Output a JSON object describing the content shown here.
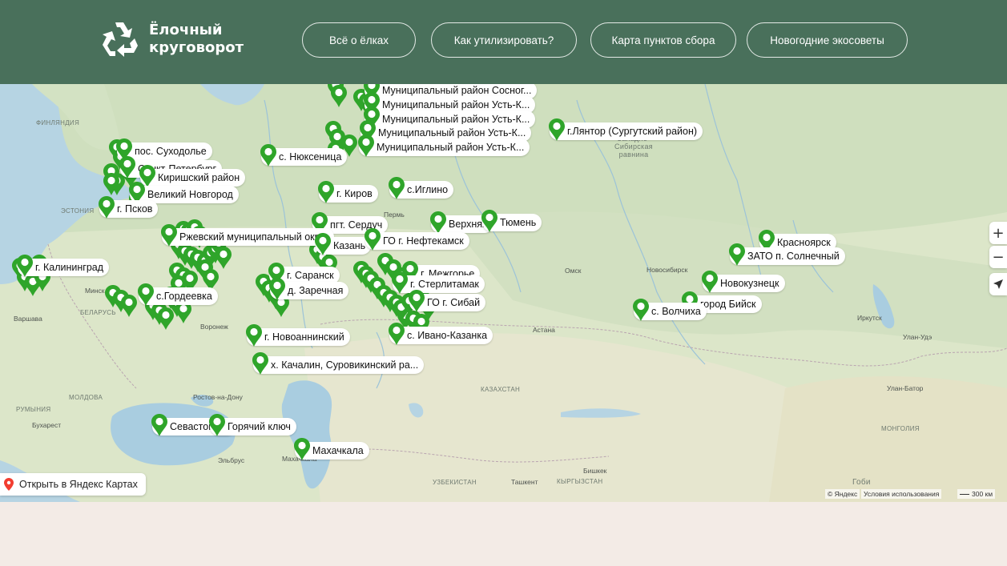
{
  "header": {
    "logo_line1": "Ёлочный",
    "logo_line2": "круговорот",
    "nav": [
      {
        "label": "Всё о ёлках"
      },
      {
        "label": "Как утилизировать?"
      },
      {
        "label": "Карта пунктов сбора"
      },
      {
        "label": "Новогодние экосоветы"
      }
    ]
  },
  "colors": {
    "header_bg": "#49705b",
    "marker_green": "#2fa52a",
    "footer_bg": "#f3ebe6"
  },
  "map": {
    "open_button": "Открыть в Яндекс Картах",
    "copyright": "© Яндекс",
    "terms": "Условия использования",
    "scale": "300 км",
    "zoom_in": "+",
    "zoom_out": "−",
    "locate_icon": "navigation-arrow-icon",
    "base_labels": [
      "ФИНЛЯНДИЯ",
      "ЭСТОНИЯ",
      "БЕЛАРУСЬ",
      "Минск",
      "Варшава",
      "Воронеж",
      "МОЛДОВА",
      "РУМЫНИЯ",
      "Бухарест",
      "Ростов-на-Дону",
      "Эльбрус",
      "Махачкала",
      "Астана",
      "КАЗАХСТАН",
      "Ташкент",
      "УЗБЕКИСТАН",
      "КЫРГЫЗСТАН",
      "Бишкек",
      "МОНГОЛИЯ",
      "Улан-Батор",
      "Улан-Удэ",
      "Иркутск",
      "Новосибирск",
      "Омск",
      "Пермь",
      "Западно-Сибирская равнина",
      "Гоби"
    ],
    "points": [
      {
        "label": "Муниципальный район Сосног..."
      },
      {
        "label": "Муниципальный район Усть-К..."
      },
      {
        "label": "Муниципальный район Усть-К..."
      },
      {
        "label": "Муниципальный район Усть-К..."
      },
      {
        "label": "Муниципальный район Усть-К..."
      },
      {
        "label": "г.Лянтор (Сургутский район)"
      },
      {
        "label": "пос. Суходолье"
      },
      {
        "label": "с. Нюксеница"
      },
      {
        "label": "Санкт-Петербург"
      },
      {
        "label": "Киришский район"
      },
      {
        "label": "Великий Новгород"
      },
      {
        "label": "г. Киров"
      },
      {
        "label": "с.Иглино"
      },
      {
        "label": "г. Псков"
      },
      {
        "label": "Верхняя"
      },
      {
        "label": "Тюмень"
      },
      {
        "label": "пгт. Сердуч"
      },
      {
        "label": "Ржевский муниципальный окр..."
      },
      {
        "label": "Казань"
      },
      {
        "label": "ГО г. Нефтекамск"
      },
      {
        "label": "г. Калининград"
      },
      {
        "label": "г. Межгорье"
      },
      {
        "label": "г. Саранск"
      },
      {
        "label": "г. Стерлитамак"
      },
      {
        "label": "д. Заречная"
      },
      {
        "label": "ГО г. Сибай"
      },
      {
        "label": "с.Гордеевка"
      },
      {
        "label": "Красноярск"
      },
      {
        "label": "ЗАТО п. Солнечный"
      },
      {
        "label": "Новокузнецк"
      },
      {
        "label": "город Бийск"
      },
      {
        "label": "с. Волчиха"
      },
      {
        "label": "г. Новоаннинский"
      },
      {
        "label": "с. Ивано-Казанка"
      },
      {
        "label": "х. Качалин, Суровикинский ра..."
      },
      {
        "label": "Севастополь"
      },
      {
        "label": "Горячий ключ"
      },
      {
        "label": "Махачкала"
      }
    ]
  }
}
